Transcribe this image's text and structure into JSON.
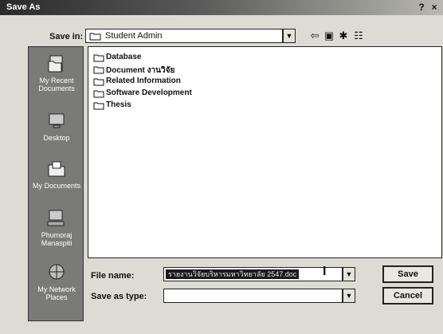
{
  "window": {
    "title": "Save As",
    "help_glyph": "?",
    "close_glyph": "×"
  },
  "save_in": {
    "label": "Save in:",
    "value": "Student Admin"
  },
  "toolbar": {
    "back": "⇦",
    "up": "▣",
    "new_folder": "✱",
    "views": "☷"
  },
  "places": [
    {
      "label": "My Recent Documents",
      "icon": "recent-documents-icon"
    },
    {
      "label": "Desktop",
      "icon": "desktop-icon"
    },
    {
      "label": "My Documents",
      "icon": "my-documents-icon"
    },
    {
      "label": "Phumoraj Manaspiti",
      "icon": "my-computer-icon"
    },
    {
      "label": "My Network Places",
      "icon": "network-places-icon"
    }
  ],
  "files": [
    {
      "name": "Database",
      "type": "folder"
    },
    {
      "name": "Document งานวิจัย",
      "type": "folder"
    },
    {
      "name": "Related Information",
      "type": "folder"
    },
    {
      "name": "Software Development",
      "type": "folder"
    },
    {
      "name": "Thesis",
      "type": "folder"
    }
  ],
  "file_name": {
    "label": "File name:",
    "value": "รายงานวิจัยบริหารมหาวิทยาลัย 2547.doc"
  },
  "save_as_type": {
    "label": "Save as type:",
    "value": ""
  },
  "buttons": {
    "save": "Save",
    "cancel": "Cancel"
  },
  "colors": {
    "titlebar": "#2a2a2a",
    "places_bg": "#7a7a78",
    "selection": "#1a1a1a"
  }
}
